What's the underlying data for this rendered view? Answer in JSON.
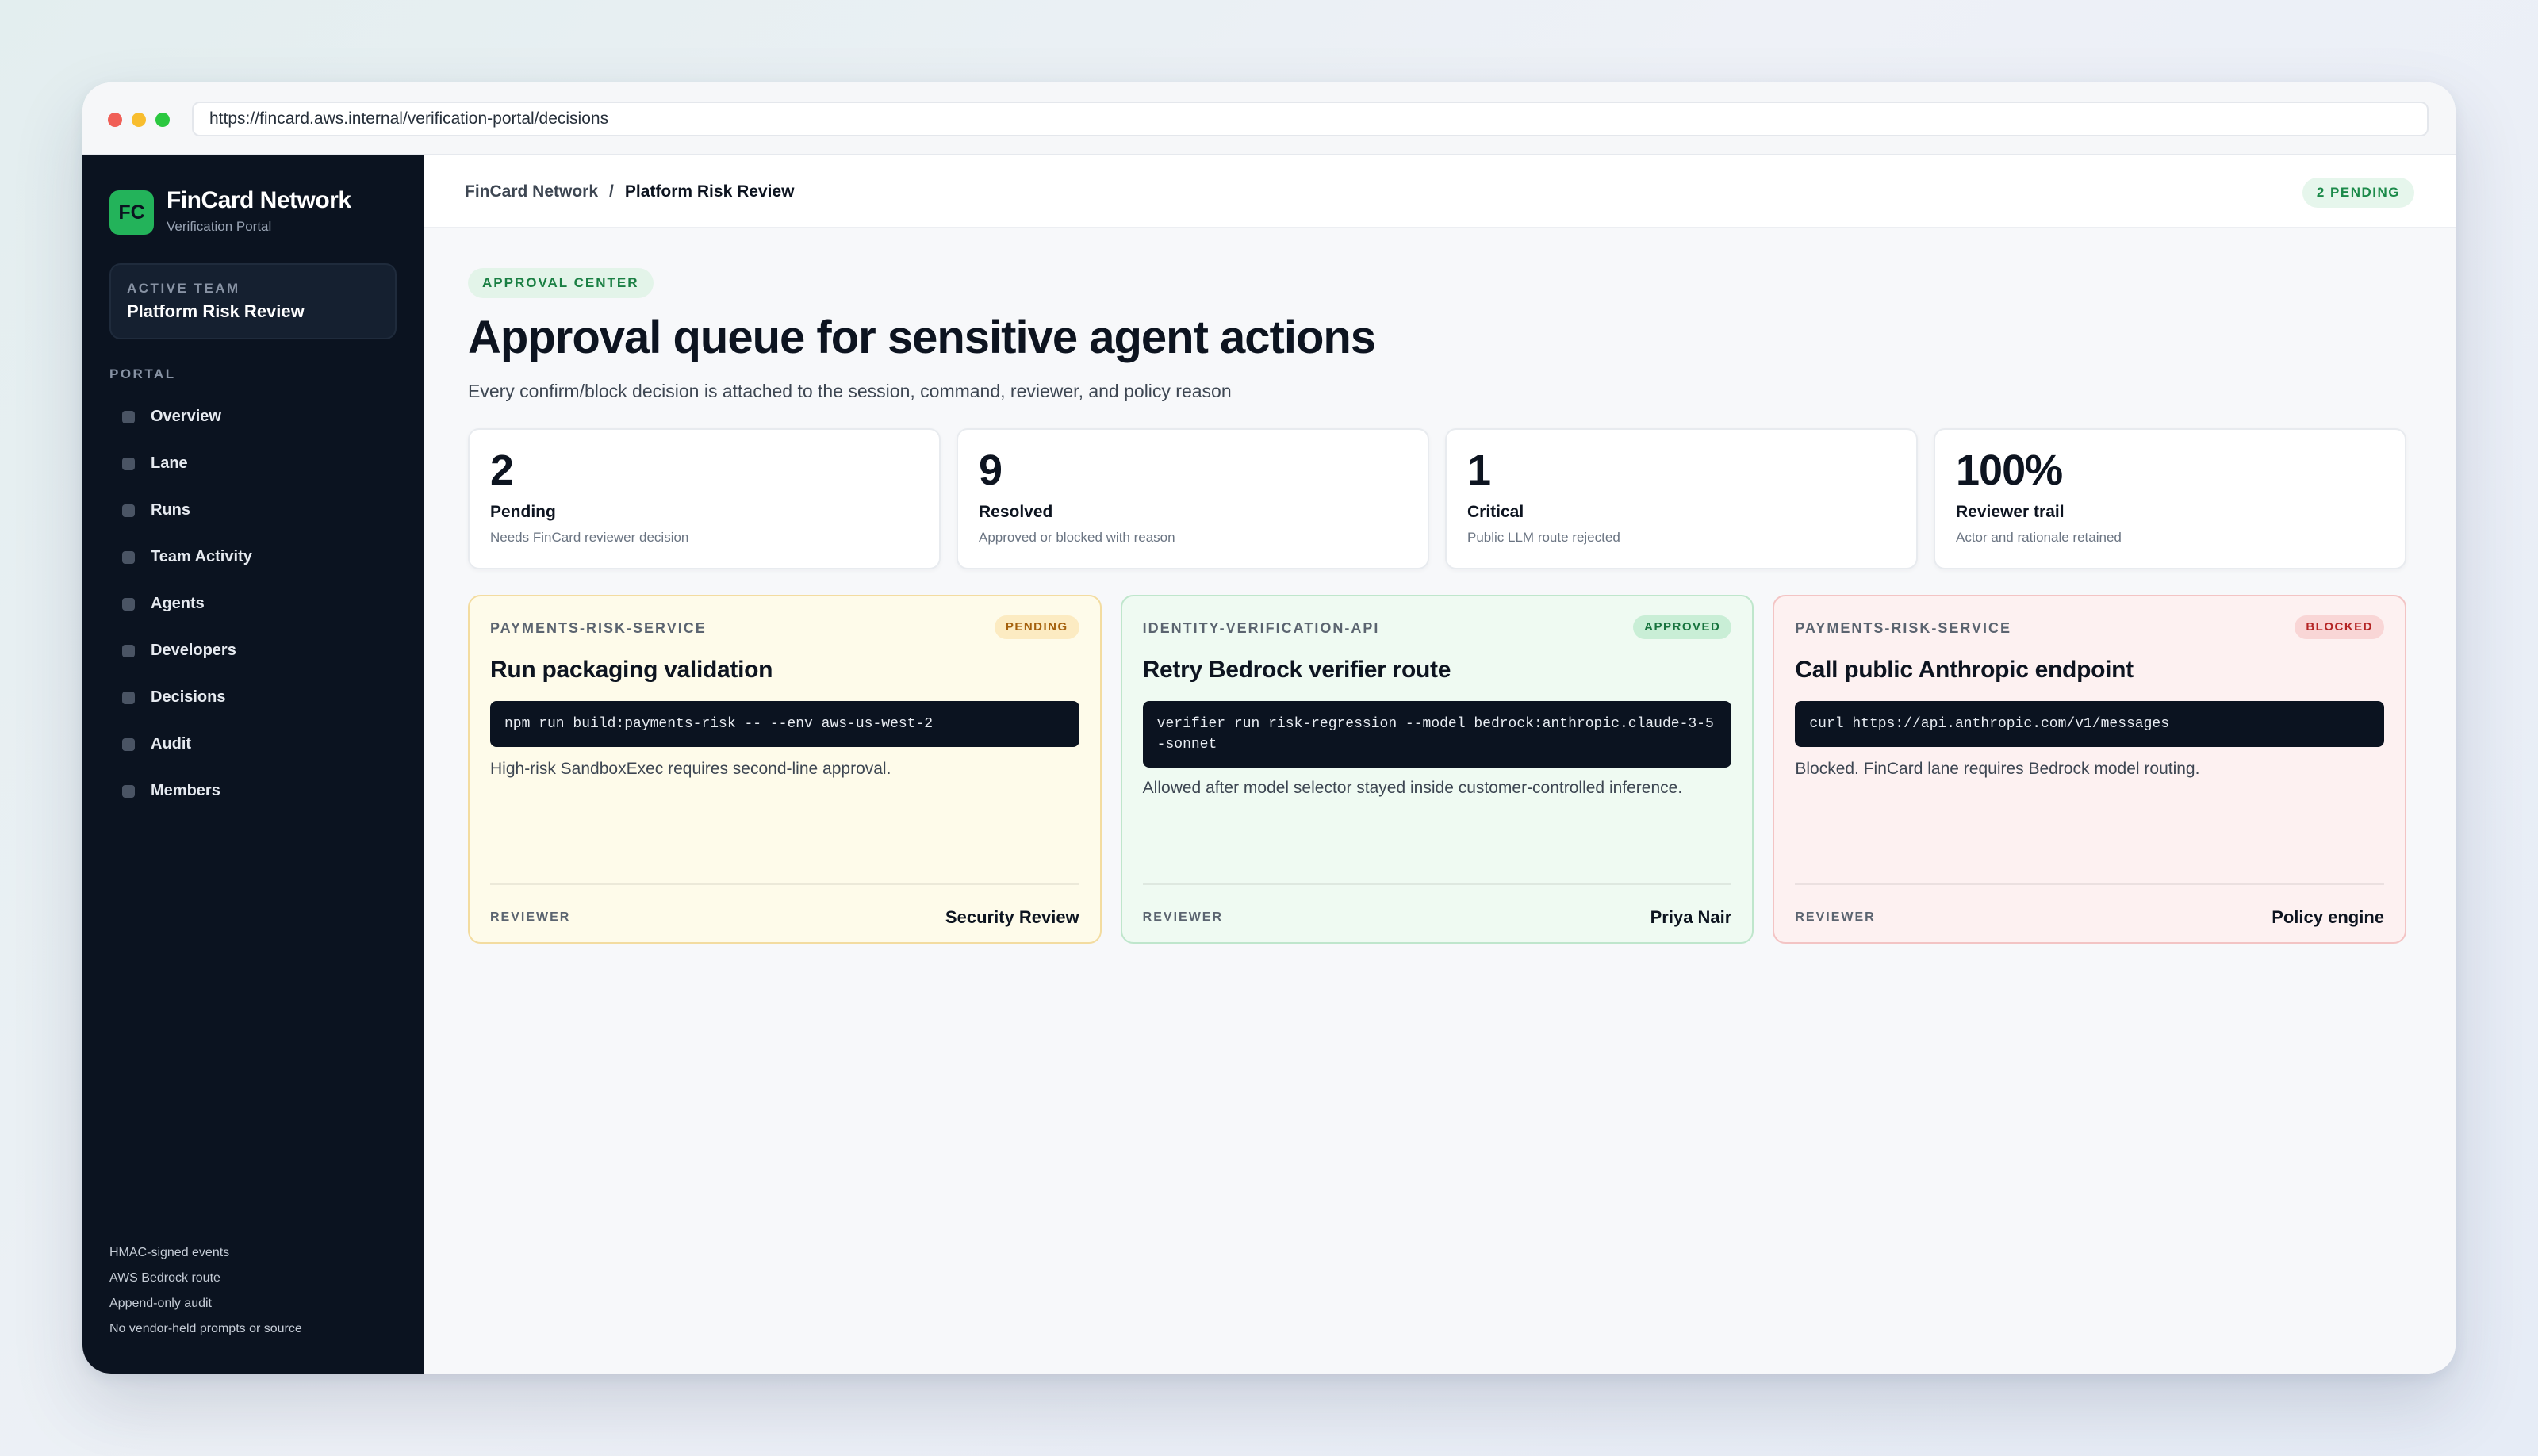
{
  "browser": {
    "url": "https://fincard.aws.internal/verification-portal/decisions"
  },
  "sidebar": {
    "logo": "FC",
    "brand_name": "FinCard Network",
    "brand_sub": "Verification Portal",
    "team_label": "ACTIVE TEAM",
    "team_name": "Platform Risk Review",
    "nav_heading": "PORTAL",
    "items": [
      {
        "label": "Overview"
      },
      {
        "label": "Lane"
      },
      {
        "label": "Runs"
      },
      {
        "label": "Team Activity"
      },
      {
        "label": "Agents"
      },
      {
        "label": "Developers"
      },
      {
        "label": "Decisions"
      },
      {
        "label": "Audit"
      },
      {
        "label": "Members"
      }
    ],
    "footer": [
      "HMAC-signed events",
      "AWS Bedrock route",
      "Append-only audit",
      "No vendor-held prompts or source"
    ]
  },
  "header": {
    "breadcrumb_root": "FinCard Network",
    "breadcrumb_sep": "/",
    "breadcrumb_current": "Platform Risk Review",
    "pending_badge": "2 PENDING"
  },
  "page": {
    "eyebrow": "APPROVAL CENTER",
    "title": "Approval queue for sensitive agent actions",
    "subtitle": "Every confirm/block decision is attached to the session, command, reviewer, and policy reason"
  },
  "stats": [
    {
      "value": "2",
      "label": "Pending",
      "desc": "Needs FinCard reviewer decision"
    },
    {
      "value": "9",
      "label": "Resolved",
      "desc": "Approved or blocked with reason"
    },
    {
      "value": "1",
      "label": "Critical",
      "desc": "Public LLM route rejected"
    },
    {
      "value": "100%",
      "label": "Reviewer trail",
      "desc": "Actor and rationale retained"
    }
  ],
  "decisions": [
    {
      "service": "PAYMENTS-RISK-SERVICE",
      "status": "PENDING",
      "title": "Run packaging validation",
      "command": "npm run build:payments-risk -- --env aws-us-west-2",
      "note": "High-risk SandboxExec requires second-line approval.",
      "reviewer_label": "REVIEWER",
      "reviewer": "Security Review"
    },
    {
      "service": "IDENTITY-VERIFICATION-API",
      "status": "APPROVED",
      "title": "Retry Bedrock verifier route",
      "command": "verifier run risk-regression --model bedrock:anthropic.claude-3-5-sonnet",
      "note": "Allowed after model selector stayed inside customer-controlled inference.",
      "reviewer_label": "REVIEWER",
      "reviewer": "Priya Nair"
    },
    {
      "service": "PAYMENTS-RISK-SERVICE",
      "status": "BLOCKED",
      "title": "Call public Anthropic endpoint",
      "command": "curl https://api.anthropic.com/v1/messages",
      "note": "Blocked. FinCard lane requires Bedrock model routing.",
      "reviewer_label": "REVIEWER",
      "reviewer": "Policy engine"
    }
  ],
  "colors": {
    "sidebar_bg": "#0b1320",
    "brand_accent": "#23b35a",
    "pending": "#a45f0b",
    "approved": "#16733d",
    "blocked": "#b42323"
  }
}
